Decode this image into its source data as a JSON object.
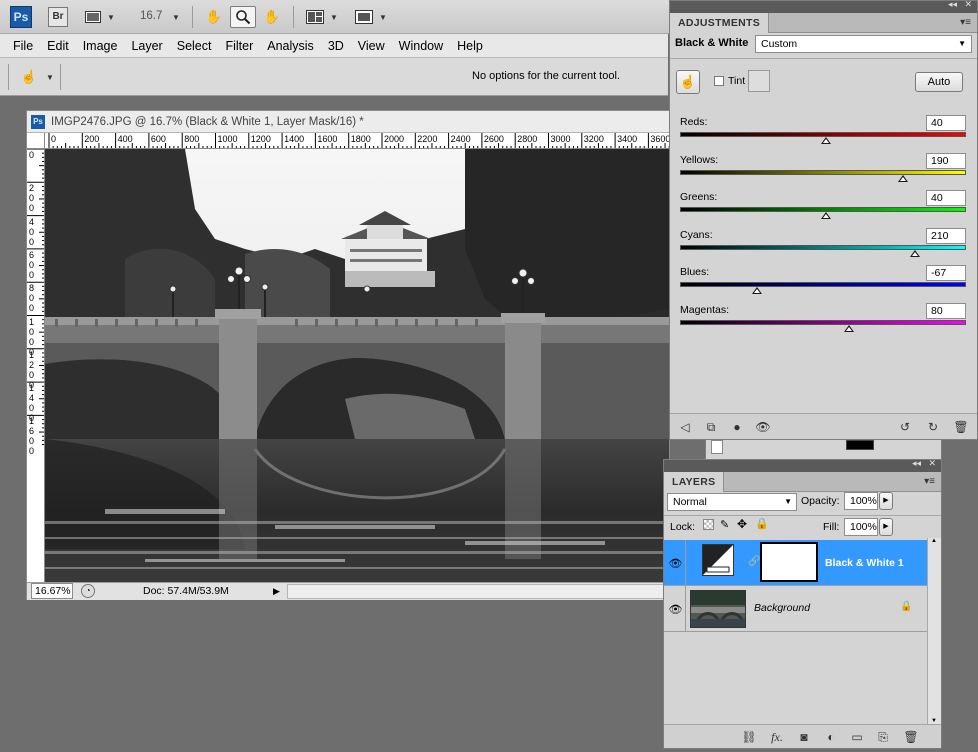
{
  "toolbar": {
    "ps_badge": "Ps",
    "br_badge": "Br",
    "zoom": "16.7"
  },
  "menu": [
    "File",
    "Edit",
    "Image",
    "Layer",
    "Select",
    "Filter",
    "Analysis",
    "3D",
    "View",
    "Window",
    "Help"
  ],
  "options_bar": {
    "message": "No options for the current tool."
  },
  "document": {
    "title": "IMGP2476.JPG @ 16.7% (Black & White 1, Layer Mask/16) *",
    "ruler_top": [
      "0",
      "200",
      "400",
      "600",
      "800",
      "1000",
      "1200",
      "1400",
      "1600",
      "1800",
      "2000",
      "2200",
      "2400",
      "2600",
      "2800",
      "3000",
      "3200",
      "3400",
      "3600"
    ],
    "ruler_left": [
      "0",
      "2\n0\n0",
      "4\n0\n0",
      "6\n0\n0",
      "8\n0\n0",
      "1\n0\n0\n0",
      "1\n2\n0\n0",
      "1\n4\n0\n0",
      "1\n6\n0\n0"
    ],
    "status_zoom": "16.67%",
    "status_doc": "Doc: 57.4M/53.9M"
  },
  "adjustments": {
    "tab": "ADJUSTMENTS",
    "title": "Black & White",
    "preset": "Custom",
    "tint_label": "Tint",
    "auto_label": "Auto",
    "sliders": [
      {
        "label": "Reds",
        "value": "40",
        "pos": 0.51,
        "gradient": "linear-gradient(90deg,#000,#ff0000)"
      },
      {
        "label": "Yellows",
        "value": "190",
        "pos": 0.78,
        "gradient": "linear-gradient(90deg,#000,#ffff00)"
      },
      {
        "label": "Greens",
        "value": "40",
        "pos": 0.51,
        "gradient": "linear-gradient(90deg,#000,#00ff00)"
      },
      {
        "label": "Cyans",
        "value": "210",
        "pos": 0.82,
        "gradient": "linear-gradient(90deg,#000,#00ffff)"
      },
      {
        "label": "Blues",
        "value": "-67",
        "pos": 0.27,
        "gradient": "linear-gradient(90deg,#000,#0000ff)"
      },
      {
        "label": "Magentas",
        "value": "80",
        "pos": 0.59,
        "gradient": "linear-gradient(90deg,#000,#ff00ff)"
      }
    ]
  },
  "layers": {
    "tab": "LAYERS",
    "blend_mode": "Normal",
    "opacity_label": "Opacity:",
    "opacity": "100%",
    "lock_label": "Lock:",
    "fill_label": "Fill:",
    "fill": "100%",
    "items": [
      {
        "name": "Black & White 1",
        "selected": true
      },
      {
        "name": "Background",
        "selected": false
      }
    ]
  },
  "colors": {
    "accent": "#3399ff",
    "ps_blue": "#1a5aa6"
  }
}
